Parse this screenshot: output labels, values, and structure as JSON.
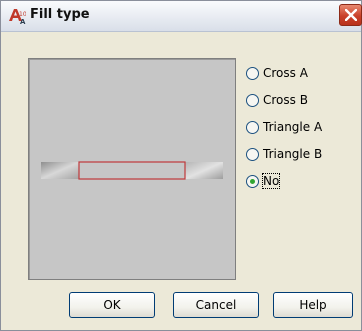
{
  "window": {
    "title": "Fill type",
    "app_icon": "autocad-architecture-icon",
    "close_icon": "close-icon"
  },
  "preview": {
    "description_icon": "fill-preview-bar"
  },
  "fill_options": [
    {
      "label": "Cross A",
      "selected": false
    },
    {
      "label": "Cross B",
      "selected": false
    },
    {
      "label": "Triangle A",
      "selected": false
    },
    {
      "label": "Triangle B",
      "selected": false
    },
    {
      "label": "No",
      "selected": true
    }
  ],
  "buttons": {
    "ok": "OK",
    "cancel": "Cancel",
    "help": "Help"
  },
  "colors": {
    "outline_red": "#c0393b",
    "radio_dot": "#31a631"
  }
}
